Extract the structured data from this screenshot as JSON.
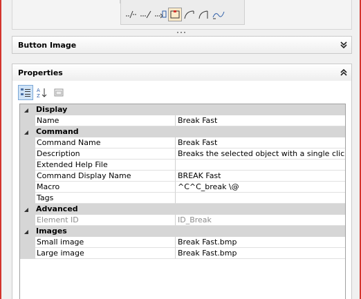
{
  "preview": {
    "icons": [
      "polyline-icon",
      "dashed-line-icon",
      "arrow-rect-icon",
      "rectangle-icon",
      "arc-icon",
      "curve-icon",
      "spline-icon"
    ]
  },
  "button_image_panel": {
    "title": "Button Image",
    "toggle_icon": "chevron-double-down-icon"
  },
  "properties_panel": {
    "title": "Properties",
    "toggle_icon": "chevron-double-up-icon",
    "toolbar": [
      "categorized-icon",
      "alphabetical-icon",
      "property-pages-icon"
    ],
    "categories": [
      {
        "label": "Display",
        "rows": [
          {
            "name": "Name",
            "value": "Break Fast"
          }
        ]
      },
      {
        "label": "Command",
        "rows": [
          {
            "name": "Command Name",
            "value": "Break Fast"
          },
          {
            "name": "Description",
            "value": "Breaks the selected object with a single click"
          },
          {
            "name": "Extended Help File",
            "value": ""
          },
          {
            "name": "Command Display Name",
            "value": "BREAK Fast"
          },
          {
            "name": "Macro",
            "value": "^C^C_break \\@"
          },
          {
            "name": "Tags",
            "value": ""
          }
        ]
      },
      {
        "label": "Advanced",
        "rows": [
          {
            "name": "Element ID",
            "value": "ID_Break",
            "readonly": true
          }
        ]
      },
      {
        "label": "Images",
        "rows": [
          {
            "name": "Small image",
            "value": "Break Fast.bmp"
          },
          {
            "name": "Large image",
            "value": "Break Fast.bmp"
          }
        ]
      }
    ]
  },
  "colors": {
    "frame": "#d3342c",
    "category_bg": "#d6d6d6",
    "selected_tool": "#fdeac8"
  }
}
